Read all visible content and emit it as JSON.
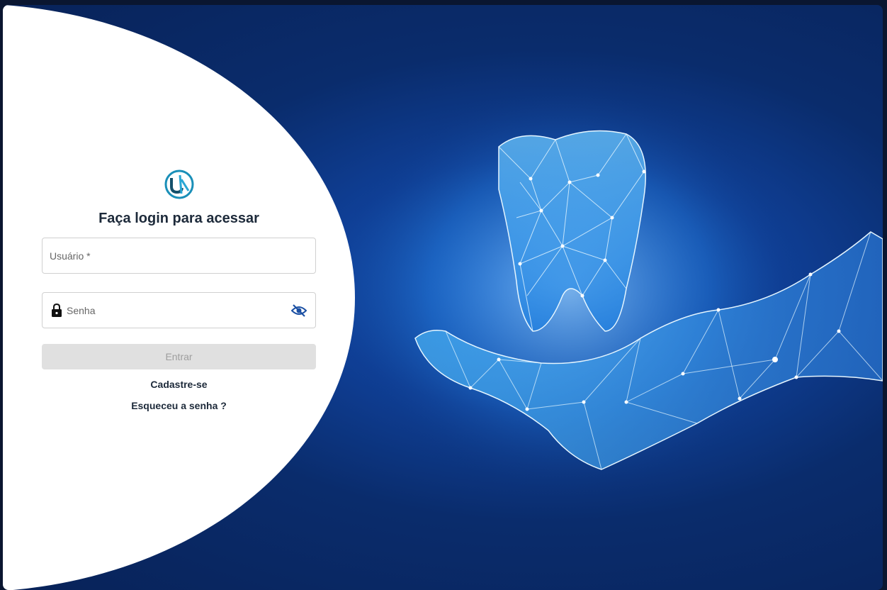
{
  "brand": {
    "logo_icon": "un-logo-icon",
    "logo_color": "#1a8fb8"
  },
  "login": {
    "title": "Faça login para acessar",
    "username_placeholder": "Usuário *",
    "username_value": "",
    "password_placeholder": "Senha",
    "password_value": "",
    "submit_label": "Entrar",
    "signup_label": "Cadastre-se",
    "forgot_label": "Esqueceu a senha ?"
  },
  "icons": {
    "lock": "lock-icon",
    "toggle_password": "eye-off-icon"
  },
  "hero": {
    "subject": "tooth-over-hand-illustration"
  },
  "colors": {
    "background": "#0a2c6c",
    "accent": "#1a4fa3",
    "panel": "#ffffff"
  }
}
